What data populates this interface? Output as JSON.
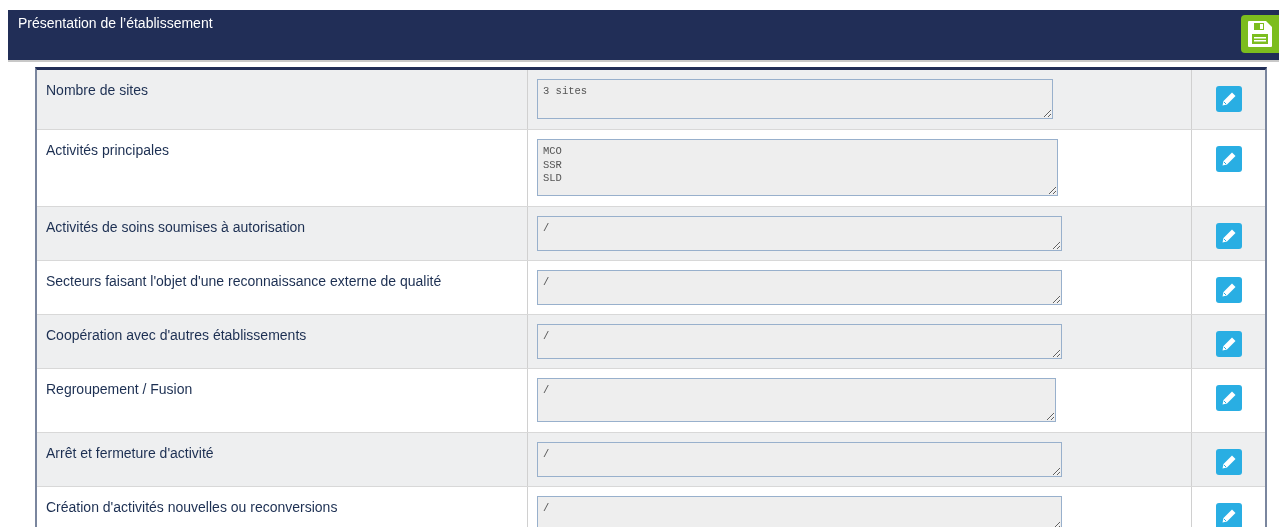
{
  "panel": {
    "title": "Présentation de l’établissement"
  },
  "rows": [
    {
      "label": "Nombre de sites",
      "value": "3 sites"
    },
    {
      "label": "Activités principales",
      "value": "MCO\nSSR\nSLD"
    },
    {
      "label": "Activités de soins soumises à autorisation",
      "value": "/"
    },
    {
      "label": "Secteurs faisant l'objet d'une reconnaissance externe de qualité",
      "value": "/"
    },
    {
      "label": "Coopération avec d'autres établissements",
      "value": "/"
    },
    {
      "label": "Regroupement / Fusion",
      "value": "/"
    },
    {
      "label": "Arrêt et fermeture d'activité",
      "value": "/"
    },
    {
      "label": "Création d'activités nouvelles ou reconversions",
      "value": "/"
    }
  ]
}
